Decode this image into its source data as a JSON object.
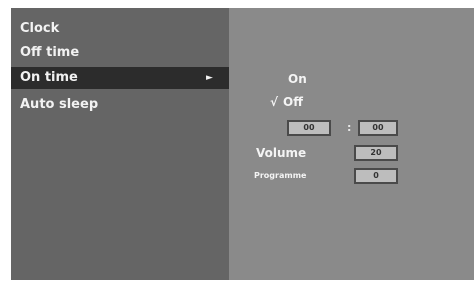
{
  "menu": {
    "items": [
      {
        "label": "Clock"
      },
      {
        "label": "Off time"
      },
      {
        "label": "On time",
        "arrow": "►"
      },
      {
        "label": "Auto sleep"
      }
    ]
  },
  "on_time": {
    "on_label": "On",
    "off_check": "√",
    "off_label": "Off",
    "hour": "00",
    "time_separator": ":",
    "minute": "00",
    "volume_label": "Volume",
    "volume_value": "20",
    "programme_label": "Programme",
    "programme_value": "0"
  }
}
